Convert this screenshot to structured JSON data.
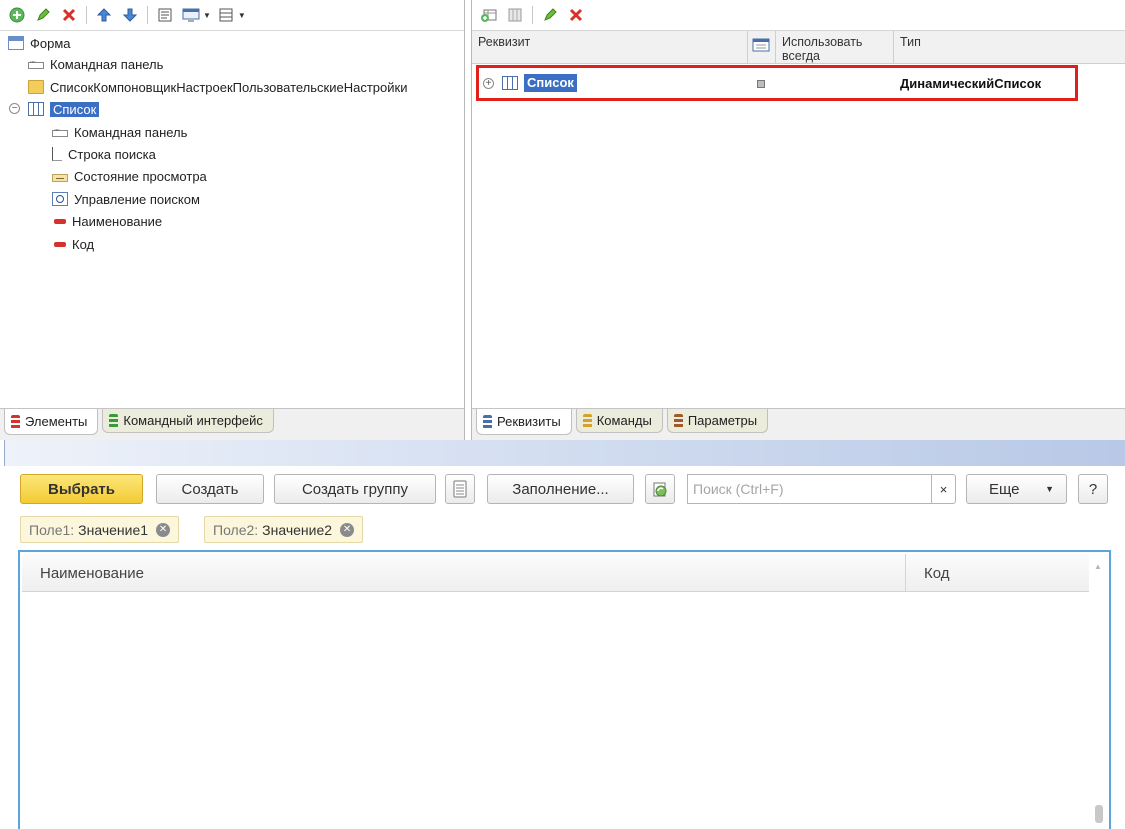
{
  "left_panel": {
    "tree": [
      {
        "label": "Форма",
        "icon": "form-icon"
      },
      {
        "label": "Командная панель",
        "icon": "command-bar-icon"
      },
      {
        "label": "СписокКомпоновщикНастроекПользовательскиеНастройки",
        "icon": "folder-icon"
      },
      {
        "label": "Список",
        "icon": "table-icon",
        "selected": true,
        "expanded": true
      },
      {
        "label": "Командная панель",
        "icon": "command-bar-icon"
      },
      {
        "label": "Строка поиска",
        "icon": "input-field-icon"
      },
      {
        "label": "Состояние просмотра",
        "icon": "view-state-icon"
      },
      {
        "label": "Управление поиском",
        "icon": "search-icon"
      },
      {
        "label": "Наименование",
        "icon": "field-red-icon"
      },
      {
        "label": "Код",
        "icon": "field-red-icon"
      }
    ],
    "tabs": [
      {
        "label": "Элементы",
        "color": "#d6322b",
        "active": true
      },
      {
        "label": "Командный интерфейс",
        "color": "#3a9a3a",
        "active": false
      }
    ]
  },
  "right_panel": {
    "columns": {
      "attribute": "Реквизит",
      "use_always": "Использовать всегда",
      "type": "Тип"
    },
    "rows": [
      {
        "name": "Список",
        "type": "ДинамическийСписок",
        "expandable": true
      }
    ],
    "tabs": [
      {
        "label": "Реквизиты",
        "color": "#4a6fa8",
        "active": true
      },
      {
        "label": "Команды",
        "color": "#d4a22a",
        "active": false
      },
      {
        "label": "Параметры",
        "color": "#a05a2c",
        "active": false
      }
    ]
  },
  "preview": {
    "buttons": {
      "select": "Выбрать",
      "create": "Создать",
      "create_group": "Создать группу",
      "fill": "Заполнение...",
      "more": "Еще",
      "help": "?"
    },
    "search": {
      "placeholder": "Поиск (Ctrl+F)",
      "clear": "×"
    },
    "filters": [
      {
        "key": "Поле1:",
        "value": "Значение1"
      },
      {
        "key": "Поле2:",
        "value": "Значение2"
      }
    ],
    "grid_columns": [
      "Наименование",
      "Код"
    ]
  },
  "colors": {
    "selection": "#3a6fc4",
    "highlight_frame": "#e0201b",
    "primary_button": "#f3cb33",
    "grid_border": "#5aa6dc"
  }
}
